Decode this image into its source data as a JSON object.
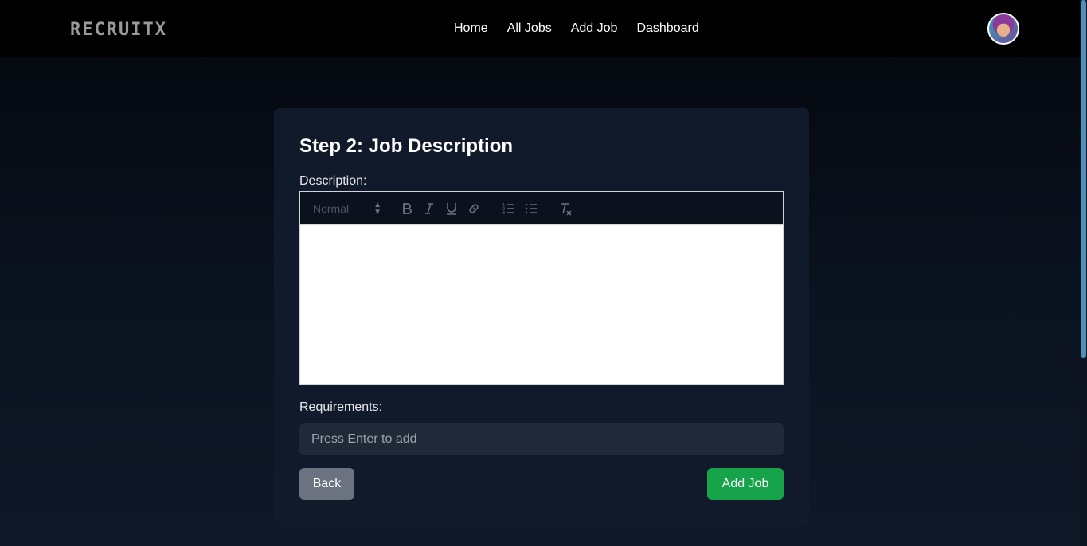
{
  "brand": {
    "logo": "RECRUITX"
  },
  "nav": {
    "links": [
      {
        "label": "Home"
      },
      {
        "label": "All Jobs"
      },
      {
        "label": "Add Job"
      },
      {
        "label": "Dashboard"
      }
    ]
  },
  "form": {
    "title": "Step 2: Job Description",
    "description_label": "Description:",
    "editor": {
      "format_select": "Normal",
      "tools": [
        "bold-icon",
        "italic-icon",
        "underline-icon",
        "link-icon",
        "ordered-list-icon",
        "bullet-list-icon",
        "clear-format-icon"
      ]
    },
    "requirements_label": "Requirements:",
    "requirements_placeholder": "Press Enter to add",
    "back_label": "Back",
    "submit_label": "Add Job"
  },
  "colors": {
    "accent_green": "#16a34a",
    "back_gray": "#6b7280",
    "card_bg": "#111a2b"
  }
}
